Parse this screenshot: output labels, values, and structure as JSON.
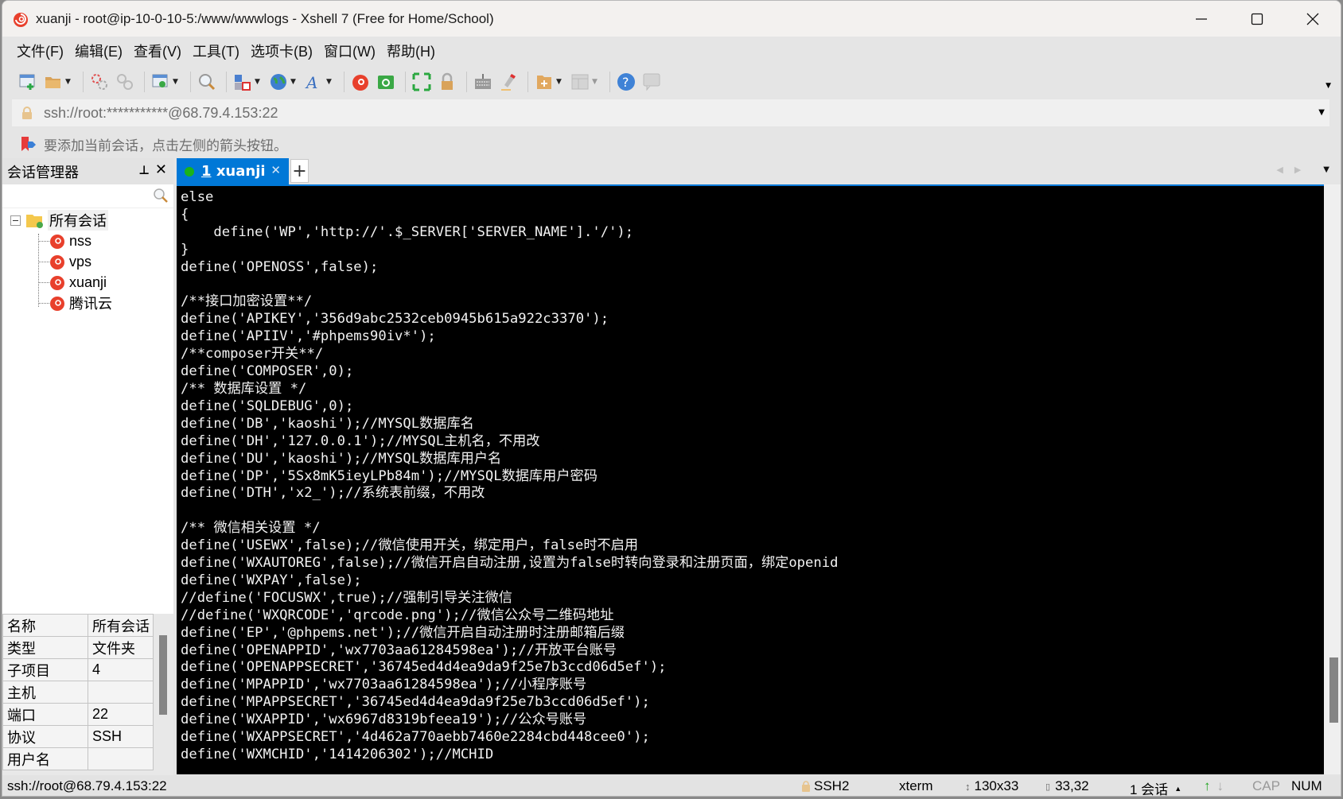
{
  "window": {
    "title": "xuanji - root@ip-10-0-10-5:/www/wwwlogs - Xshell 7 (Free for Home/School)",
    "controls": [
      "minimize",
      "maximize",
      "close"
    ]
  },
  "menu": {
    "items": [
      {
        "label": "文件(F)"
      },
      {
        "label": "编辑(E)"
      },
      {
        "label": "查看(V)"
      },
      {
        "label": "工具(T)"
      },
      {
        "label": "选项卡(B)"
      },
      {
        "label": "窗口(W)"
      },
      {
        "label": "帮助(H)"
      }
    ]
  },
  "toolbar": {
    "icons": [
      "new-session",
      "open-folder",
      "connect",
      "disconnect",
      "session-properties",
      "find",
      "transfer",
      "globe",
      "font",
      "xshell",
      "xftp",
      "fullscreen",
      "lock",
      "keyboard",
      "highlight",
      "new-folder",
      "layout",
      "help",
      "chat"
    ]
  },
  "address": {
    "value": "ssh://root:***********@68.79.4.153:22"
  },
  "hint": {
    "text": "要添加当前会话，点击左侧的箭头按钮。"
  },
  "session_manager": {
    "title": "会话管理器",
    "search_placeholder": "",
    "root": {
      "label": "所有会话"
    },
    "sessions": [
      {
        "label": "nss"
      },
      {
        "label": "vps"
      },
      {
        "label": "xuanji"
      },
      {
        "label": "腾讯云"
      }
    ],
    "properties": [
      {
        "key": "名称",
        "value": "所有会话"
      },
      {
        "key": "类型",
        "value": "文件夹"
      },
      {
        "key": "子项目",
        "value": "4"
      },
      {
        "key": "主机",
        "value": ""
      },
      {
        "key": "端口",
        "value": "22"
      },
      {
        "key": "协议",
        "value": "SSH"
      },
      {
        "key": "用户名",
        "value": ""
      }
    ]
  },
  "tabs": [
    {
      "number": "1",
      "label": "xuanji",
      "active": true,
      "status_color": "#1ab31a"
    }
  ],
  "terminal": {
    "scroll_position": 0.93,
    "lines": [
      "else",
      "{",
      "    define('WP','http://'.$_SERVER['SERVER_NAME'].'/');",
      "}",
      "define('OPENOSS',false);",
      "",
      "/**接口加密设置**/",
      "define('APIKEY','356d9abc2532ceb0945b615a922c3370');",
      "define('APIIV','#phpems90iv*');",
      "/**composer开关**/",
      "define('COMPOSER',0);",
      "/** 数据库设置 */",
      "define('SQLDEBUG',0);",
      "define('DB','kaoshi');//MYSQL数据库名",
      "define('DH','127.0.0.1');//MYSQL主机名，不用改",
      "define('DU','kaoshi');//MYSQL数据库用户名",
      "define('DP','5Sx8mK5ieyLPb84m');//MYSQL数据库用户密码",
      "define('DTH','x2_');//系统表前缀，不用改",
      "",
      "/** 微信相关设置 */",
      "define('USEWX',false);//微信使用开关，绑定用户，false时不启用",
      "define('WXAUTOREG',false);//微信开启自动注册,设置为false时转向登录和注册页面，绑定openid",
      "define('WXPAY',false);",
      "//define('FOCUSWX',true);//强制引导关注微信",
      "//define('WXQRCODE','qrcode.png');//微信公众号二维码地址",
      "define('EP','@phpems.net');//微信开启自动注册时注册邮箱后缀",
      "define('OPENAPPID','wx7703aa61284598ea');//开放平台账号",
      "define('OPENAPPSECRET','36745ed4d4ea9da9f25e7b3ccd06d5ef');",
      "define('MPAPPID','wx7703aa61284598ea');//小程序账号",
      "define('MPAPPSECRET','36745ed4d4ea9da9f25e7b3ccd06d5ef');",
      "define('WXAPPID','wx6967d8319bfeea19');//公众号账号",
      "define('WXAPPSECRET','4d462a770aebb7460e2284cbd448cee0');",
      "define('WXMCHID','1414206302');//MCHID"
    ]
  },
  "statusbar": {
    "connection": "ssh://root@68.79.4.153:22",
    "protocol": "SSH2",
    "terminal_type": "xterm",
    "size": "130x33",
    "cursor": "33,32",
    "sessions": "1 会话",
    "cap": "CAP",
    "num": "NUM"
  },
  "colors": {
    "accent": "#0078d7",
    "terminal_bg": "#000000",
    "terminal_fg": "#f2f2f2",
    "connected": "#1ab31a"
  }
}
